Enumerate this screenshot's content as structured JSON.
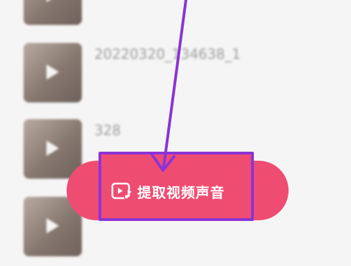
{
  "video_list": {
    "items": [
      {
        "name": "",
        "meta": ""
      },
      {
        "name": "20220320_134638_1",
        "meta": ""
      },
      {
        "name": "328",
        "meta": ""
      },
      {
        "name": "",
        "meta": ""
      }
    ]
  },
  "extract_button": {
    "label": "提取视频声音",
    "icon": "video-music-icon",
    "color": "#ef4c72"
  },
  "annotation": {
    "color": "#8c33d6"
  }
}
